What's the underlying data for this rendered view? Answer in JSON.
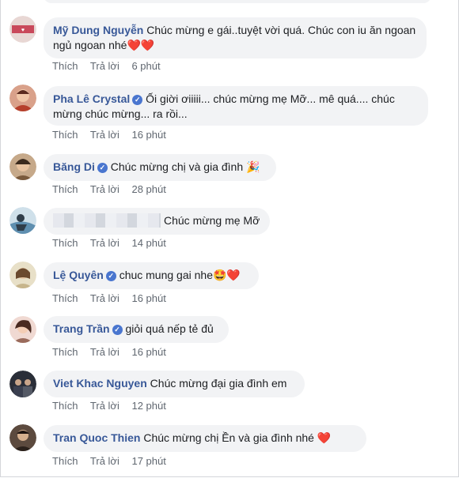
{
  "comments": [
    {
      "author": "Mỹ Dung Nguyễn",
      "verified": false,
      "text": "Chúc mừng e gái..tuyệt vời quá. Chúc con iu ăn ngoan ngủ ngoan nhé",
      "emoji": "❤️❤️",
      "like": "Thích",
      "reply": "Trả lời",
      "time": "6 phút",
      "avatar_color": "#c9495b"
    },
    {
      "author": "Pha Lê Crystal",
      "verified": true,
      "text": "Ối giời ơiiiii... chúc mừng mẹ Mỡ... mê quá.... chúc mừng chúc mừng... ra rồi...",
      "emoji": "",
      "like": "Thích",
      "reply": "Trả lời",
      "time": "16 phút",
      "avatar_color": "#b6402c"
    },
    {
      "author": "Băng Di",
      "verified": true,
      "text": "Chúc mừng chị và gia đình",
      "emoji": "🎉",
      "like": "Thích",
      "reply": "Trả lời",
      "time": "28 phút",
      "avatar_color": "#7a5a3c"
    },
    {
      "author": "",
      "verified": false,
      "text": "Chúc mừng mẹ Mỡ",
      "emoji": "",
      "like": "Thích",
      "reply": "Trả lời",
      "time": "14 phút",
      "avatar_color": "#5f8fb0"
    },
    {
      "author": "Lệ Quyên",
      "verified": true,
      "text": "chuc mung gai nhe",
      "emoji": "🤩❤️",
      "like": "Thích",
      "reply": "Trả lời",
      "time": "16 phút",
      "avatar_color": "#c7b58c"
    },
    {
      "author": "Trang Trần",
      "verified": true,
      "text": "giỏi quá nếp tẻ đủ",
      "emoji": "",
      "like": "Thích",
      "reply": "Trả lời",
      "time": "16 phút",
      "avatar_color": "#9a6b5c"
    },
    {
      "author": "Viet Khac Nguyen",
      "verified": false,
      "text": "Chúc mừng đại gia đình em",
      "emoji": "",
      "like": "Thích",
      "reply": "Trả lời",
      "time": "12 phút",
      "avatar_color": "#3a3f4f"
    },
    {
      "author": "Tran Quoc Thien",
      "verified": false,
      "text": "Chúc mừng chị Ền và gia đình nhé",
      "emoji": "❤️",
      "like": "Thích",
      "reply": "Trả lời",
      "time": "17 phút",
      "avatar_color": "#4b3a30"
    }
  ],
  "colors": {
    "author": "#385898",
    "bubble": "#f2f3f5",
    "meta": "#606770",
    "verified": "#4a76cf",
    "heart": "#e0245e"
  }
}
